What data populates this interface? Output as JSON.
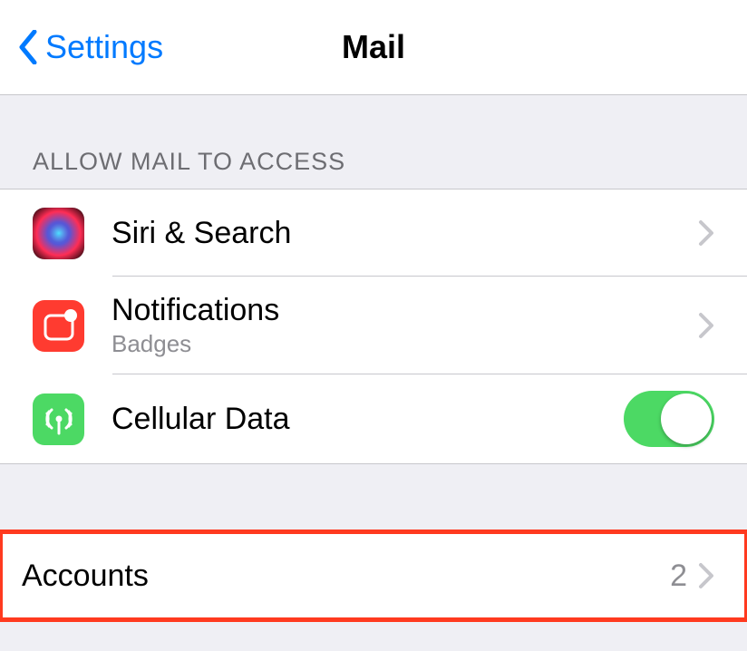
{
  "nav": {
    "back_label": "Settings",
    "title": "Mail"
  },
  "section1": {
    "header": "ALLOW MAIL TO ACCESS",
    "rows": {
      "siri": {
        "label": "Siri & Search"
      },
      "notifications": {
        "label": "Notifications",
        "sublabel": "Badges"
      },
      "cellular": {
        "label": "Cellular Data",
        "toggle_on": true
      }
    }
  },
  "section2": {
    "accounts": {
      "label": "Accounts",
      "value": "2"
    }
  }
}
